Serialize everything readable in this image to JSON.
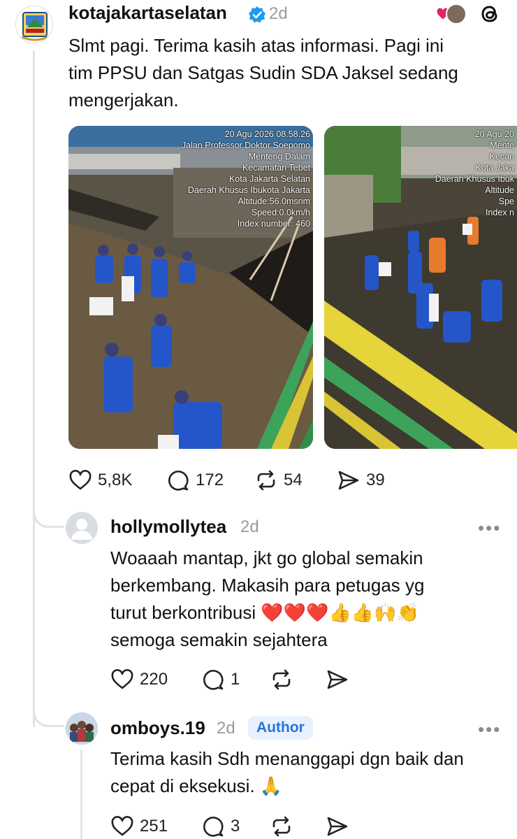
{
  "post": {
    "username": "kotajakartaselatan",
    "time": "2d",
    "text_lines": [
      "Slmt pagi. Terima kasih atas informasi. Pagi ini",
      "tim PPSU dan Satgas Sudin SDA Jaksel sedang",
      "mengerjakan."
    ],
    "photo1_stamp": [
      "20 Agu 2026 08.58.26",
      "Jalan Professor Doktor Soepomo",
      "Menteng Dalam",
      "Kecamatan Tebet",
      "Kota Jakarta Selatan",
      "Daerah Khusus Ibukota Jakarta",
      "Altitude:56.0msnm",
      "Speed:0.0km/h",
      "Index number: 460"
    ],
    "photo2_stamp": [
      "20 Agu 20",
      "Mente",
      "Kecan",
      "Kota Jaka",
      "Daerah Khusus Ibuk",
      "Altitude",
      "Spe",
      "Index n"
    ],
    "likes": "5,8K",
    "comments": "172",
    "reposts": "54",
    "shares": "39"
  },
  "reply1": {
    "username": "hollymollytea",
    "time": "2d",
    "text_lines": [
      "Woaaah mantap, jkt go global semakin",
      "berkembang. Makasih para petugas yg",
      "turut berkontribusi ❤️❤️❤️👍👍🙌👏",
      "semoga semakin sejahtera"
    ],
    "likes": "220",
    "comments": "1"
  },
  "reply2": {
    "username": "omboys.19",
    "time": "2d",
    "badge": "Author",
    "text_lines": [
      "Terima kasih Sdh menanggapi dgn baik dan",
      "cepat di eksekusi. 🙏"
    ],
    "likes": "251",
    "comments": "3"
  },
  "more_label": "•••",
  "colors": {
    "accent": "#2a74d8",
    "badge_bg": "#e8f1fd",
    "verified": "#1d9bf0",
    "like_red": "#e0245e"
  },
  "icons": [
    "heart-icon",
    "comment-icon",
    "repost-icon",
    "share-icon",
    "threads-logo-icon",
    "verified-icon",
    "more-icon"
  ]
}
